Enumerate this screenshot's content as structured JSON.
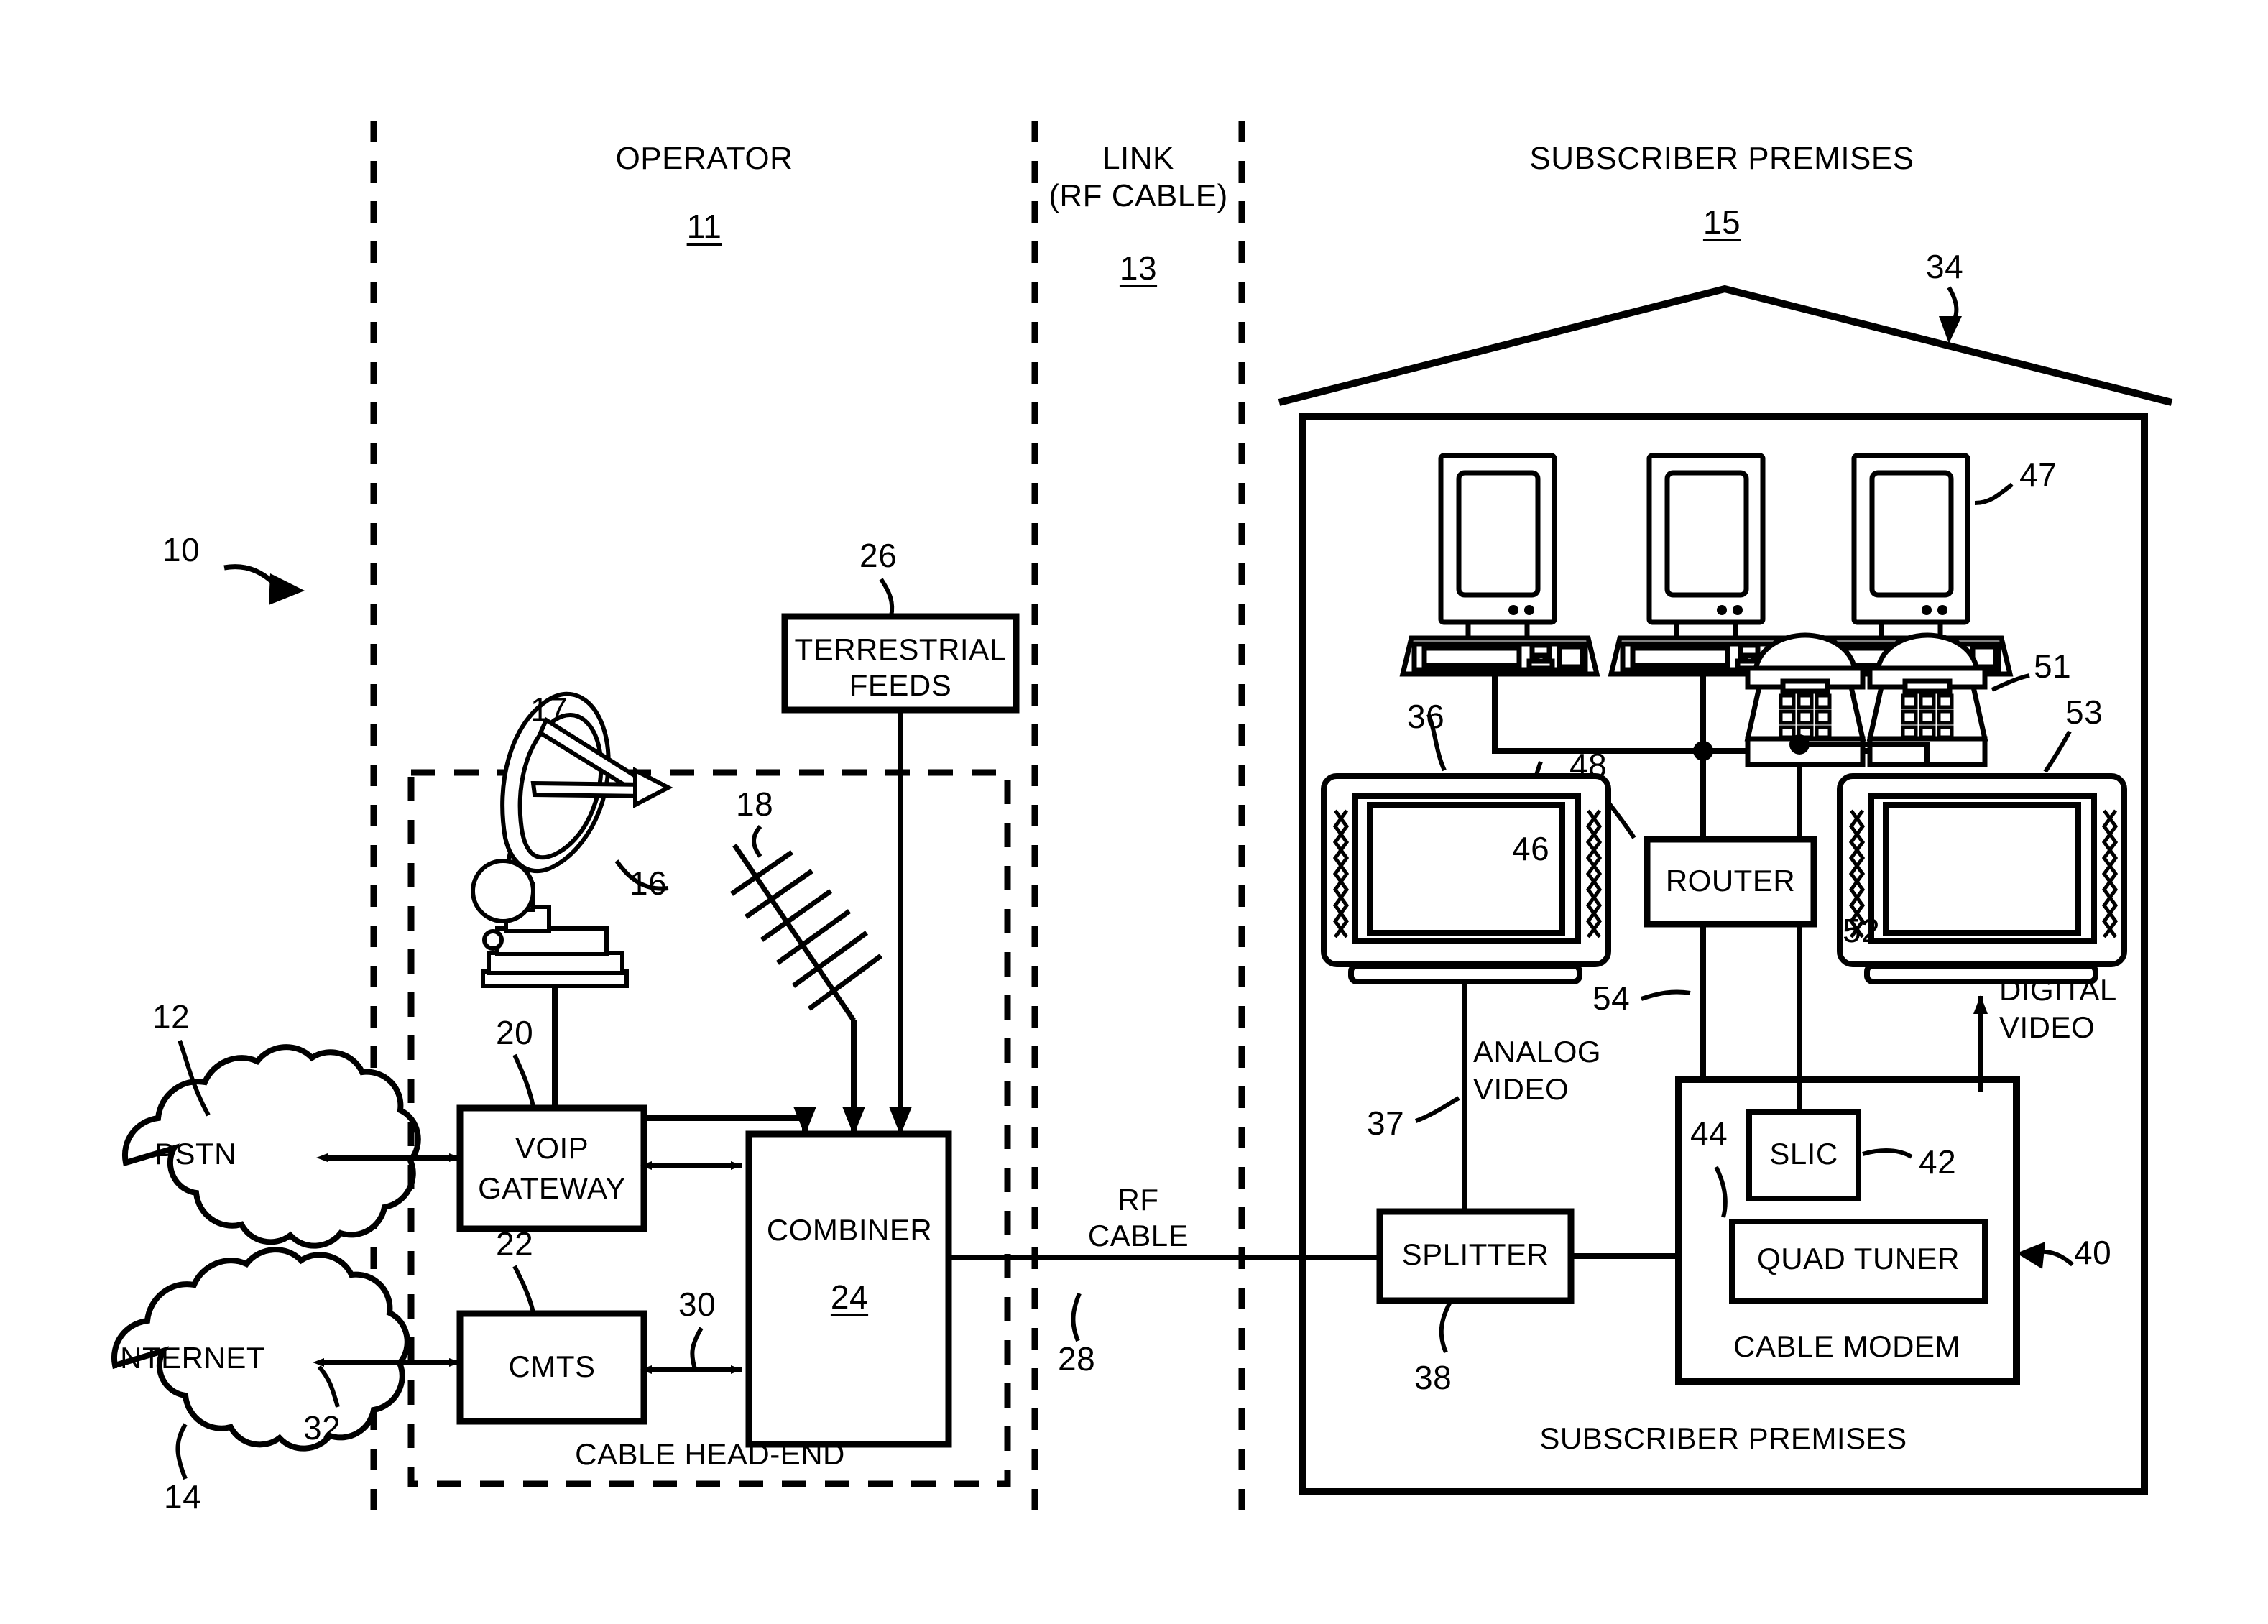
{
  "figure": {
    "system_ref": "10",
    "columns": [
      {
        "name": "operator",
        "title": "OPERATOR",
        "ref": "11"
      },
      {
        "name": "link",
        "title_line1": "LINK",
        "title_line2": "(RF CABLE)",
        "ref": "13"
      },
      {
        "name": "subscriber",
        "title": "SUBSCRIBER PREMISES",
        "ref": "15"
      }
    ]
  },
  "operator": {
    "clouds": [
      {
        "label": "PSTN",
        "ref": "12"
      },
      {
        "label": "INTERNET",
        "ref": "14"
      }
    ],
    "internet_link_ref": "32",
    "head_end": {
      "caption": "CABLE HEAD-END",
      "ref": "17",
      "blocks": [
        {
          "label": "VOIP\nGATEWAY",
          "ref": "20"
        },
        {
          "label": "CMTS",
          "ref": "22"
        },
        {
          "label": "COMBINER",
          "ref": "24"
        }
      ],
      "cmts_combiner_link_ref": "30"
    },
    "satellite_dish_ref": "16",
    "antenna_ref": "18",
    "terrestrial_feeds": {
      "label": "TERRESTRIAL\nFEEDS",
      "ref": "26"
    }
  },
  "link": {
    "cable_label": "RF\nCABLE",
    "cable_ref": "28"
  },
  "subscriber": {
    "house_roof_ref": "34",
    "caption": "SUBSCRIBER PREMISES",
    "computers_ref": "47",
    "computer_bus_ref": "46",
    "phones_ref": "51",
    "phone_bus_ref": "52",
    "tv_analog_ref": "36",
    "tv_digital_ref": "53",
    "analog_video_label": "ANALOG\nVIDEO",
    "analog_video_ref": "37",
    "digital_video_label": "DIGITAL\nVIDEO",
    "splitter": {
      "label": "SPLITTER",
      "ref": "38"
    },
    "router": {
      "label": "ROUTER",
      "ref": "48"
    },
    "router_link_ref": "54",
    "cable_modem": {
      "label": "CABLE MODEM",
      "ref": "40",
      "slic": {
        "label": "SLIC",
        "ref": "42"
      },
      "quad_tuner": {
        "label": "QUAD TUNER",
        "ref": "44"
      }
    }
  },
  "colors": {
    "ink": "#000000",
    "paper": "#ffffff"
  }
}
